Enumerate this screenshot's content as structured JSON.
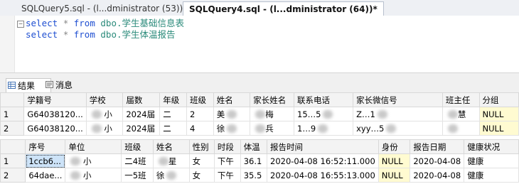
{
  "tabs": [
    {
      "label": "SQLQuery5.sql - (l...dministrator (53))*"
    },
    {
      "label": "SQLQuery4.sql - (l...dministrator (64))*"
    }
  ],
  "editor": {
    "lines": [
      {
        "kw": "select",
        "star": "*",
        "from": "from",
        "schema": "dbo.",
        "table": "学生基础信息表"
      },
      {
        "kw": "select",
        "star": "*",
        "from": "from",
        "schema": "dbo.",
        "table": "学生体温报告"
      }
    ]
  },
  "result_tabs": {
    "results": "结果",
    "messages": "消息"
  },
  "grid1": {
    "columns": [
      "学籍号",
      "学校",
      "届数",
      "年级",
      "班级",
      "姓名",
      "家长姓名",
      "联系电话",
      "家长微信号",
      "班主任",
      "分组"
    ],
    "rows": [
      [
        "1",
        "G64038120...",
        "小",
        "2024届",
        "二",
        "2",
        "美",
        "梅",
        "15…5",
        "Z…1",
        "慧",
        "NULL"
      ],
      [
        "2",
        "G64038120...",
        "小",
        "2024届",
        "二",
        "4",
        "徐",
        "兵",
        "1…9",
        "xyy…5",
        "",
        "NULL"
      ]
    ]
  },
  "grid2": {
    "columns": [
      "序号",
      "单位",
      "班级",
      "姓名",
      "性别",
      "时段",
      "体温",
      "报告时间",
      "身份",
      "报告日期",
      "健康状况"
    ],
    "rows": [
      [
        "1",
        "1ccb6...",
        "小",
        "二4班",
        "星",
        "女",
        "下午",
        "36.1",
        "2020-04-08 16:52:11.000",
        "NULL",
        "2020-04-08",
        "健康"
      ],
      [
        "2",
        "64dae...",
        "小",
        "一5班",
        "徐",
        "女",
        "下午",
        "35.5",
        "2020-04-08 16:55:13.000",
        "NULL",
        "2020-04-08",
        "健康"
      ]
    ]
  }
}
